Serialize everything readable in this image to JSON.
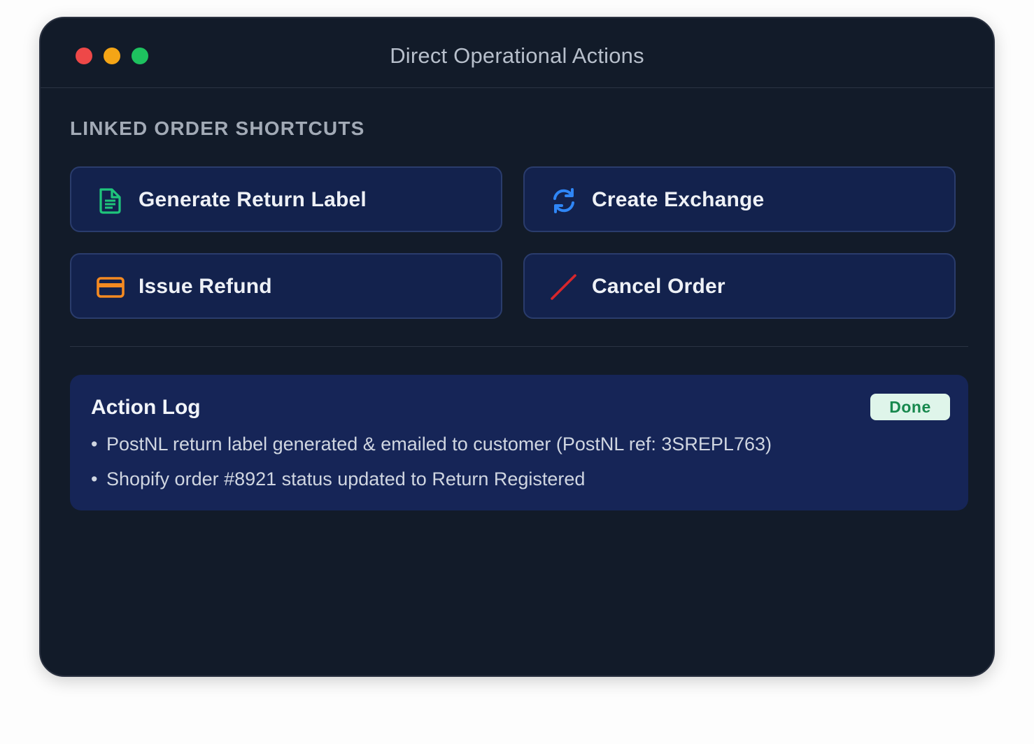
{
  "window": {
    "title": "Direct Operational Actions",
    "controls": [
      "close",
      "minimize",
      "maximize"
    ]
  },
  "shortcuts": {
    "heading": "LINKED ORDER SHORTCUTS",
    "buttons": [
      {
        "label": "Generate Return Label",
        "icon": "document-icon",
        "icon_color": "#1fc57b"
      },
      {
        "label": "Create Exchange",
        "icon": "refresh-icon",
        "icon_color": "#2f86f6"
      },
      {
        "label": "Issue Refund",
        "icon": "credit-card-icon",
        "icon_color": "#f48a21"
      },
      {
        "label": "Cancel Order",
        "icon": "slash-icon",
        "icon_color": "#d8262c"
      }
    ]
  },
  "action_log": {
    "title": "Action Log",
    "status": "Done",
    "bullet": "•",
    "entries": [
      "PostNL return label generated & emailed to customer (PostNL ref: 3SREPL763)",
      "Shopify order #8921 status updated to Return Registered"
    ]
  },
  "colors": {
    "window_bg": "#121b29",
    "button_bg": "#13224d",
    "panel_bg": "#162557",
    "badge_bg": "#dff5ea",
    "badge_text": "#17884d"
  }
}
